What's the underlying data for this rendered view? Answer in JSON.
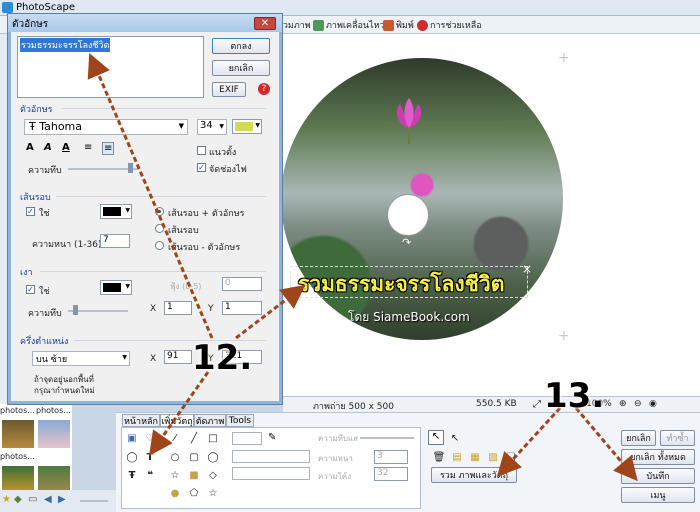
{
  "app": {
    "title": "PhotoScape"
  },
  "menu": [
    {
      "label": "รวมภาพ",
      "color": "#6a8fbf"
    },
    {
      "label": "ภาพเคลื่อนไหว",
      "color": "#4a9a55"
    },
    {
      "label": "พิมพ์",
      "color": "#c85a2c"
    },
    {
      "label": "การช่วยเหลือ",
      "color": "#d22b2b"
    }
  ],
  "canvas": {
    "title_text": "รวมธรรมะจรรโลงชีวิต",
    "credit_text": "โดย SiameBook.com"
  },
  "status": {
    "size": "ภาพถ่าย 500 x 500",
    "filesize": "550.5 KB",
    "zoom": "100%"
  },
  "thumbnails": {
    "labels": [
      "photos...",
      "photos...",
      "photos..."
    ]
  },
  "dialog": {
    "title": "ตัวอักษร",
    "text_value": "รวมธรรมะจรรโลงชีวิต",
    "ok_button": "ตกลง",
    "cancel_button": "ยกเลิก",
    "exif_button": "EXIF",
    "help_icon_label": "?",
    "font_section": "ตัวอักษร",
    "font_name": "Tahoma",
    "font_size": "34",
    "font_color": "#d5d95a",
    "vertical_label": "แนวตั้ง",
    "justify_label": "จัดช่องไฟ",
    "opacity_label": "ความทึบ",
    "outline_section": "เส้นรอบ",
    "use_label": "ใช่",
    "outline_text_label": "เส้นรอบ + ตัวอักษร",
    "outline_only_label": "เส้นรอบ",
    "outline_minus_label": "เส้นรอบ - ตัวอักษร",
    "thickness_label": "ความหนา (1-36)",
    "thickness_value": "7",
    "shadow_section": "เงา",
    "shadow_use_label": "ใช่",
    "spread_label": "ฟุ้ง (0-5)",
    "spread_value": "0",
    "shadow_opacity_label": "ความทึบ",
    "x_label": "X",
    "y_label": "Y",
    "shadow_x": "1",
    "shadow_y": "1",
    "anchor_section": "ครึ่งตำแหน่ง",
    "anchor_value": "บน ซ้าย",
    "anchor_x": "91",
    "anchor_y": "321",
    "anchor_note_1": "ถ้าจุดอยู่นอกพื้นที่",
    "anchor_note_2": "กรุณากำหนดใหม่"
  },
  "bottom": {
    "tabs": [
      "หน้าหลัก",
      "เพิ่มวัตถุ",
      "ตัดภาพ",
      "Tools"
    ],
    "opacity_label": "ความทึบแส",
    "thickness_label": "ความหนา",
    "thickness_value": "3",
    "corner_label": "ความโค้ง",
    "corner_value": "32",
    "merge_button": "รวม ภาพและวัตถุ",
    "cancel_button": "ยกเลิก",
    "redo_button": "ทำซ้ำ",
    "cancel_all_button": "ยกเลิก ทั้งหมด",
    "save_button": "บันทึก",
    "menu_button": "เมนู"
  },
  "annotations": {
    "step12": "12.",
    "step13": "13."
  }
}
